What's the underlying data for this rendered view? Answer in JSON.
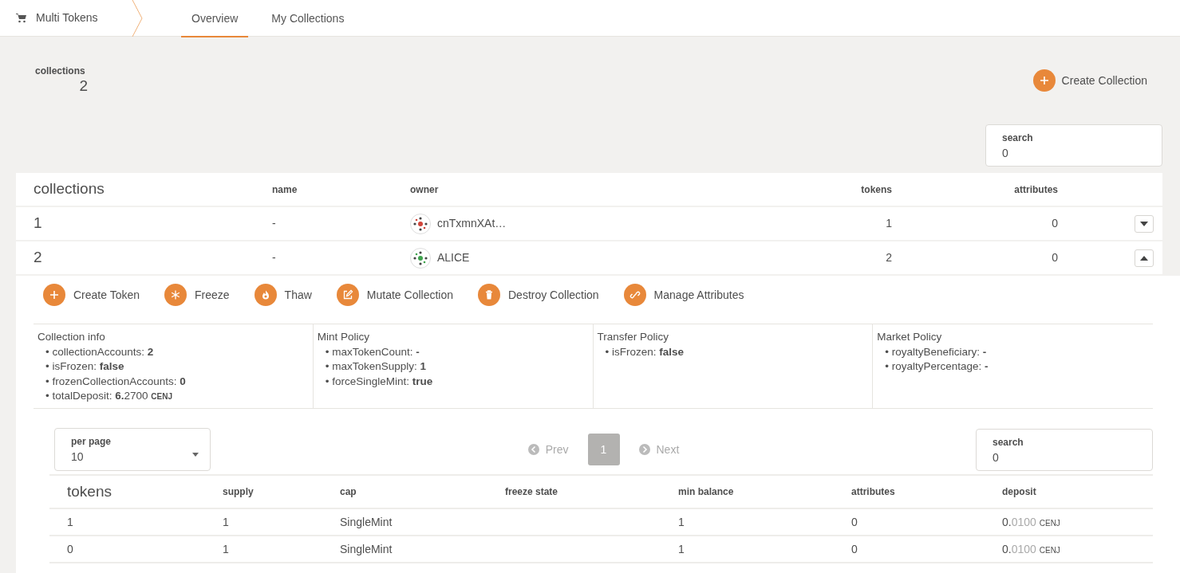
{
  "app": {
    "title": "Multi Tokens"
  },
  "tabs": [
    {
      "label": "Overview",
      "selected": true
    },
    {
      "label": "My Collections",
      "selected": false
    }
  ],
  "summary": {
    "label": "collections",
    "value": "2"
  },
  "create_collection_button": "Create Collection",
  "search": {
    "label": "search",
    "value": "0"
  },
  "collections_table": {
    "columns": [
      "collections",
      "name",
      "owner",
      "tokens",
      "attributes"
    ],
    "rows": [
      {
        "id": "1",
        "name": "-",
        "owner": "cnTxmnXAt…",
        "tokens": "1",
        "attributes": "0",
        "expanded": false
      },
      {
        "id": "2",
        "name": "-",
        "owner": "ALICE",
        "tokens": "2",
        "attributes": "0",
        "expanded": true
      }
    ]
  },
  "actions": [
    {
      "kind": "plus",
      "label": "Create Token"
    },
    {
      "kind": "snowflake",
      "label": "Freeze"
    },
    {
      "kind": "flame",
      "label": "Thaw"
    },
    {
      "kind": "edit",
      "label": "Mutate Collection"
    },
    {
      "kind": "trash",
      "label": "Destroy Collection"
    },
    {
      "kind": "link",
      "label": "Manage Attributes"
    }
  ],
  "policies": [
    {
      "title": "Collection info",
      "items": [
        {
          "text": "• collectionAccounts: **2**"
        },
        {
          "text": "• isFrozen: **false**"
        },
        {
          "text": "• frozenCollectionAccounts: **0**"
        },
        {
          "text": "• totalDeposit: **6.**2700",
          "unit": "CENJ"
        }
      ]
    },
    {
      "title": "Mint Policy",
      "items": [
        {
          "text": "• maxTokenCount: **-**"
        },
        {
          "text": "• maxTokenSupply: **1**"
        },
        {
          "text": "• forceSingleMint: **true**"
        }
      ]
    },
    {
      "title": "Transfer Policy",
      "items": [
        {
          "text": "• isFrozen: **false**"
        }
      ]
    },
    {
      "title": "Market Policy",
      "items": [
        {
          "text": "• royaltyBeneficiary: **-**"
        },
        {
          "text": "• royaltyPercentage: **-**"
        }
      ]
    }
  ],
  "per_page": {
    "label": "per page",
    "value": "10"
  },
  "pagination": {
    "prev": "Prev",
    "next": "Next",
    "pages": [
      {
        "label": "1",
        "selected": true
      }
    ]
  },
  "token_search": {
    "label": "search",
    "value": "0"
  },
  "tokens_table": {
    "columns": [
      "tokens",
      "supply",
      "cap",
      "freeze state",
      "min balance",
      "attributes",
      "deposit"
    ],
    "rows": [
      {
        "cells": [
          "1",
          "1",
          "SingleMint",
          "",
          "1",
          "0"
        ],
        "deposit": {
          "whole": "0.",
          "fraction": "0100",
          "unit": "CENJ"
        }
      },
      {
        "cells": [
          "0",
          "1",
          "SingleMint",
          "",
          "1",
          "0"
        ],
        "deposit": {
          "whole": "0.",
          "fraction": "0100",
          "unit": "CENJ"
        }
      }
    ]
  }
}
